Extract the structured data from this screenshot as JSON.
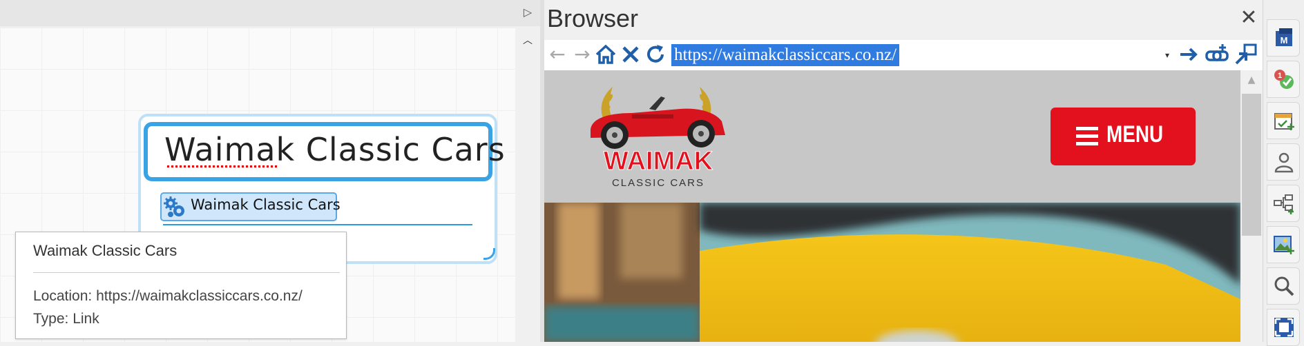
{
  "left_pane": {
    "topic": {
      "title": "Waimak Classic Cars",
      "link_label": "Waimak Classic Cars"
    },
    "tooltip": {
      "title": "Waimak Classic Cars",
      "location": "Location: https://waimakclassiccars.co.nz/",
      "type": "Type: Link"
    }
  },
  "browser": {
    "title": "Browser",
    "close_glyph": "✕",
    "url": "https://waimakclassiccars.co.nz/",
    "nav": {
      "back": "←",
      "forward": "→",
      "home": "⌂",
      "stop": "✕",
      "refresh": "↻"
    },
    "site": {
      "logo_text": "WAIMAK",
      "logo_subtext": "CLASSIC CARS",
      "menu_label": "MENU",
      "brand_red": "#e3111e",
      "header_grey": "#c7c7c7"
    }
  },
  "side_toolbar": {
    "buttons": [
      {
        "icon": "notebook-icon"
      },
      {
        "icon": "task-badge-icon"
      },
      {
        "icon": "calendar-add-icon"
      },
      {
        "icon": "person-icon"
      },
      {
        "icon": "map-add-icon"
      },
      {
        "icon": "image-add-icon"
      },
      {
        "icon": "search-icon"
      },
      {
        "icon": "fit-screen-icon"
      }
    ]
  },
  "colors": {
    "selection_blue": "#2f7be0",
    "topic_border": "#3aa3e6",
    "nav_icon_blue": "#1f5fa8"
  }
}
